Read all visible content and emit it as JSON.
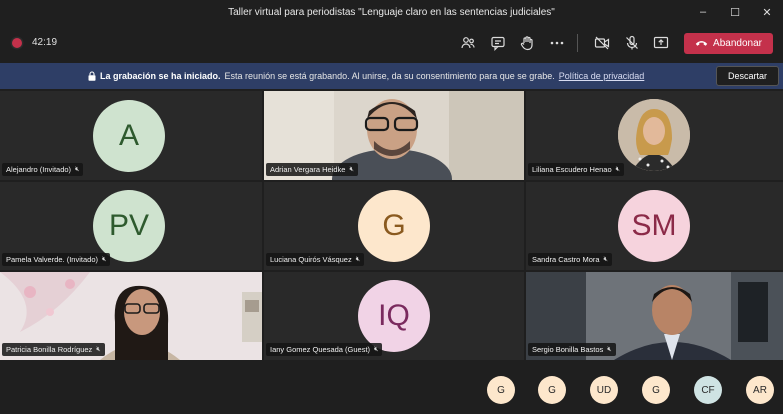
{
  "window": {
    "title": "Taller virtual para periodistas \"Lenguaje claro en las sentencias judiciales\""
  },
  "call": {
    "timer": "42:19",
    "leave_label": "Abandonar"
  },
  "banner": {
    "bold_text": "La grabación se ha iniciado.",
    "text": "Esta reunión se está grabando. Al unirse, da su consentimiento para que se grabe.",
    "link_text": "Política de privacidad",
    "dismiss_label": "Descartar"
  },
  "participants": [
    {
      "name": "Alejandro (Invitado)",
      "initials": "A",
      "avatar_color": "#cfe3cf",
      "text_color": "#2e5a2e",
      "video": false
    },
    {
      "name": "Adrian Vergara Heidke",
      "initials": "",
      "video": true
    },
    {
      "name": "Liliana Escudero Henao",
      "initials": "",
      "video": true
    },
    {
      "name": "Pamela Valverde. (Invitado)",
      "initials": "PV",
      "avatar_color": "#cfe3cf",
      "text_color": "#2e5a2e",
      "video": false
    },
    {
      "name": "Luciana Quirós Vásquez",
      "initials": "G",
      "avatar_color": "#fde7cc",
      "text_color": "#8a5a1f",
      "video": false
    },
    {
      "name": "Sandra Castro Mora",
      "initials": "SM",
      "avatar_color": "#f6d3dd",
      "text_color": "#8b2a48",
      "video": false
    },
    {
      "name": "Patricia Bonilla Rodríguez",
      "initials": "",
      "video": true
    },
    {
      "name": "Iany Gomez Quesada (Guest)",
      "initials": "IQ",
      "avatar_color": "#f1d3e6",
      "text_color": "#7a2a5e",
      "video": false
    },
    {
      "name": "Sergio Bonilla Bastos",
      "initials": "",
      "video": true
    }
  ],
  "overflow": [
    {
      "initials": "G",
      "color": "#fde7cc"
    },
    {
      "initials": "G",
      "color": "#fde7cc"
    },
    {
      "initials": "UD",
      "color": "#fde7cc"
    },
    {
      "initials": "G",
      "color": "#fde7cc"
    },
    {
      "initials": "CF",
      "color": "#cfe3e3"
    },
    {
      "initials": "AR",
      "color": "#fde7cc"
    }
  ],
  "icons": {
    "record": "record-dot-icon",
    "people": "people-icon",
    "chat": "chat-icon",
    "raise_hand": "raise-hand-icon",
    "more": "more-options-icon",
    "camera_off": "camera-off-icon",
    "mic_off": "mic-off-icon",
    "share": "share-screen-icon",
    "hangup": "hangup-phone-icon",
    "lock": "lock-icon"
  }
}
